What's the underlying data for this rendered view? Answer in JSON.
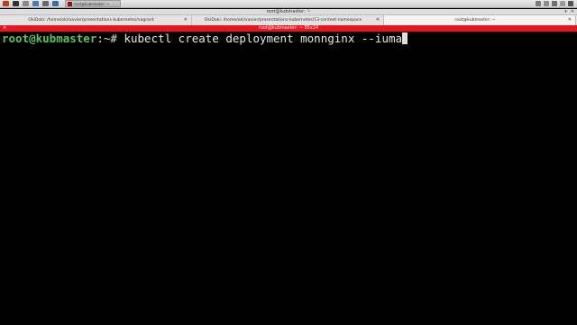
{
  "panel": {
    "taskbar_item": "root@kubmaster: ~",
    "colors": {
      "task_square": "#a01010"
    }
  },
  "window": {
    "title": "root@kubmaster: ~",
    "controls": [
      "▾",
      "✕"
    ]
  },
  "tabs": [
    {
      "label": "OkiDoki: /home/oki/xavier/presentations-kubernetes/vagrant",
      "close": "✕"
    },
    {
      "label": "OkiDoki: /home/oki/xavier/presentations-kubernetes/13-context-namespace",
      "close": "✕"
    },
    {
      "label": "root@kubmaster: ~",
      "close": "✕"
    }
  ],
  "terminal": {
    "geometry_label": "root@kubmaster: ~ 95x24",
    "bar_color": "#e9141e",
    "prompt_user_host": "root@kubmaster",
    "prompt_path": ":~# ",
    "command": "kubectl create deployment monnginx --iuma"
  }
}
